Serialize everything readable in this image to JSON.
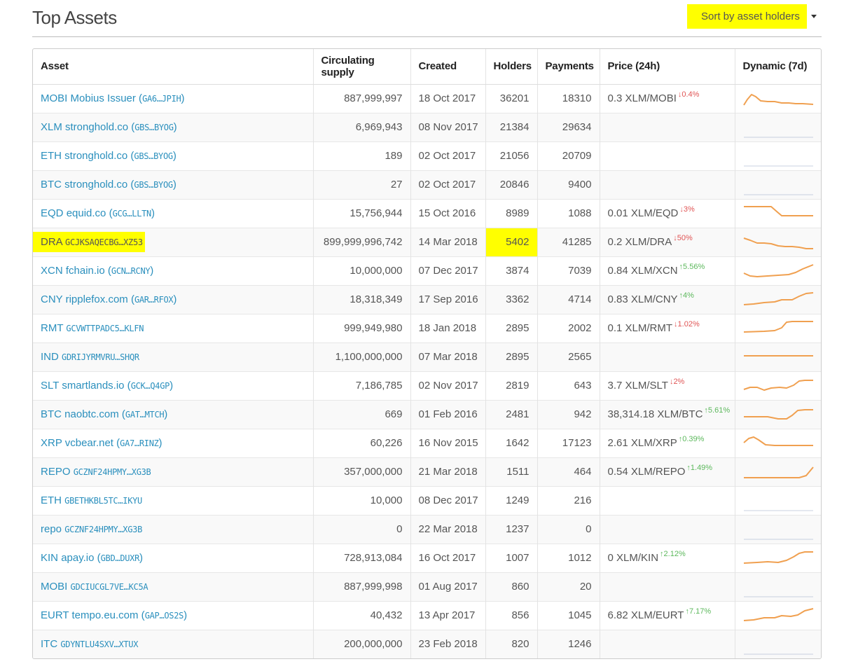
{
  "header": {
    "title": "Top Assets",
    "sort_label": "Sort by asset holders"
  },
  "table": {
    "columns": [
      "Asset",
      "Circulating supply",
      "Created",
      "Holders",
      "Payments",
      "Price (24h)",
      "Dynamic (7d)"
    ],
    "rows": [
      {
        "code": "MOBI",
        "domain": "Mobius Issuer",
        "issuer": "GA6…JPIH",
        "supply": "887,999,997",
        "created": "18 Oct 2017",
        "holders": "36201",
        "payments": "18310",
        "price": "0.3 XLM/MOBI",
        "change": "↓0.4%",
        "dir": "down",
        "spark": "peak_early"
      },
      {
        "code": "XLM",
        "domain": "stronghold.co",
        "issuer": "GBS…BYOG",
        "supply": "6,969,943",
        "created": "08 Nov 2017",
        "holders": "21384",
        "payments": "29634",
        "price": "",
        "change": "",
        "dir": "",
        "spark": "empty"
      },
      {
        "code": "ETH",
        "domain": "stronghold.co",
        "issuer": "GBS…BYOG",
        "supply": "189",
        "created": "02 Oct 2017",
        "holders": "21056",
        "payments": "20709",
        "price": "",
        "change": "",
        "dir": "",
        "spark": "empty"
      },
      {
        "code": "BTC",
        "domain": "stronghold.co",
        "issuer": "GBS…BYOG",
        "supply": "27",
        "created": "02 Oct 2017",
        "holders": "20846",
        "payments": "9400",
        "price": "",
        "change": "",
        "dir": "",
        "spark": "empty"
      },
      {
        "code": "EQD",
        "domain": "equid.co",
        "issuer": "GCG…LLTN",
        "supply": "15,756,944",
        "created": "15 Oct 2016",
        "holders": "8989",
        "payments": "1088",
        "price": "0.01 XLM/EQD",
        "change": "↓3%",
        "dir": "down",
        "spark": "step_down"
      },
      {
        "code": "DRA",
        "domain": "",
        "issuer": "GCJKSAQECBG…XZ53",
        "supply": "899,999,996,742",
        "created": "14 Mar 2018",
        "holders": "5402",
        "payments": "41285",
        "price": "0.2 XLM/DRA",
        "change": "↓50%",
        "dir": "down",
        "spark": "decline",
        "highlight": true
      },
      {
        "code": "XCN",
        "domain": "fchain.io",
        "issuer": "GCN…RCNY",
        "supply": "10,000,000",
        "created": "07 Dec 2017",
        "holders": "3874",
        "payments": "7039",
        "price": "0.84 XLM/XCN",
        "change": "↑5.56%",
        "dir": "up",
        "spark": "rise_smooth"
      },
      {
        "code": "CNY",
        "domain": "ripplefox.com",
        "issuer": "GAR…RFOX",
        "supply": "18,318,349",
        "created": "17 Sep 2016",
        "holders": "3362",
        "payments": "4714",
        "price": "0.83 XLM/CNY",
        "change": "↑4%",
        "dir": "up",
        "spark": "rise_steps"
      },
      {
        "code": "RMT",
        "domain": "",
        "issuer": "GCVWTTPADC5…KLFN",
        "supply": "999,949,980",
        "created": "18 Jan 2018",
        "holders": "2895",
        "payments": "2002",
        "price": "0.1 XLM/RMT",
        "change": "↓1.02%",
        "dir": "down",
        "spark": "step_up"
      },
      {
        "code": "IND",
        "domain": "",
        "issuer": "GDRIJYRMVRU…SHQR",
        "supply": "1,100,000,000",
        "created": "07 Mar 2018",
        "holders": "2895",
        "payments": "2565",
        "price": "",
        "change": "",
        "dir": "",
        "spark": "flat_orange"
      },
      {
        "code": "SLT",
        "domain": "smartlands.io",
        "issuer": "GCK…Q4GP",
        "supply": "7,186,785",
        "created": "02 Nov 2017",
        "holders": "2819",
        "payments": "643",
        "price": "3.7 XLM/SLT",
        "change": "↓2%",
        "dir": "down",
        "spark": "wavy_up"
      },
      {
        "code": "BTC",
        "domain": "naobtc.com",
        "issuer": "GAT…MTCH",
        "supply": "669",
        "created": "01 Feb 2016",
        "holders": "2481",
        "payments": "942",
        "price": "38,314.18 XLM/BTC",
        "change": "↑5.61%",
        "dir": "up",
        "spark": "dip_up"
      },
      {
        "code": "XRP",
        "domain": "vcbear.net",
        "issuer": "GA7…RINZ",
        "supply": "60,226",
        "created": "16 Nov 2015",
        "holders": "1642",
        "payments": "17123",
        "price": "2.61 XLM/XRP",
        "change": "↑0.39%",
        "dir": "up",
        "spark": "peak_early2"
      },
      {
        "code": "REPO",
        "domain": "",
        "issuer": "GCZNF24HPMY…XG3B",
        "supply": "357,000,000",
        "created": "21 Mar 2018",
        "holders": "1511",
        "payments": "464",
        "price": "0.54 XLM/REPO",
        "change": "↑1.49%",
        "dir": "up",
        "spark": "late_spike"
      },
      {
        "code": "ETH",
        "domain": "",
        "issuer": "GBETHKBL5TC…IKYU",
        "supply": "10,000",
        "created": "08 Dec 2017",
        "holders": "1249",
        "payments": "216",
        "price": "",
        "change": "",
        "dir": "",
        "spark": "empty"
      },
      {
        "code": "repo",
        "domain": "",
        "issuer": "GCZNF24HPMY…XG3B",
        "supply": "0",
        "created": "22 Mar 2018",
        "holders": "1237",
        "payments": "0",
        "price": "",
        "change": "",
        "dir": "",
        "spark": "empty"
      },
      {
        "code": "KIN",
        "domain": "apay.io",
        "issuer": "GBD…DUXR",
        "supply": "728,913,084",
        "created": "16 Oct 2017",
        "holders": "1007",
        "payments": "1012",
        "price": "0 XLM/KIN",
        "change": "↑2.12%",
        "dir": "up",
        "spark": "rise_late"
      },
      {
        "code": "MOBI",
        "domain": "",
        "issuer": "GDCIUCGL7VE…KC5A",
        "supply": "887,999,998",
        "created": "01 Aug 2017",
        "holders": "860",
        "payments": "20",
        "price": "",
        "change": "",
        "dir": "",
        "spark": "empty"
      },
      {
        "code": "EURT",
        "domain": "tempo.eu.com",
        "issuer": "GAP…OS2S",
        "supply": "40,432",
        "created": "13 Apr 2017",
        "holders": "856",
        "payments": "1045",
        "price": "6.82 XLM/EURT",
        "change": "↑7.17%",
        "dir": "up",
        "spark": "rise_steps2"
      },
      {
        "code": "ITC",
        "domain": "",
        "issuer": "GDYNTLU4SXV…XTUX",
        "supply": "200,000,000",
        "created": "23 Feb 2018",
        "holders": "820",
        "payments": "1246",
        "price": "",
        "change": "",
        "dir": "",
        "spark": "empty"
      }
    ]
  },
  "colors": {
    "highlight": "#ffff00",
    "link": "#2a8fbd",
    "spark": "#f0a050",
    "spark_empty": "#c8d0e0",
    "down": "#e05555",
    "up": "#5cb85c"
  }
}
